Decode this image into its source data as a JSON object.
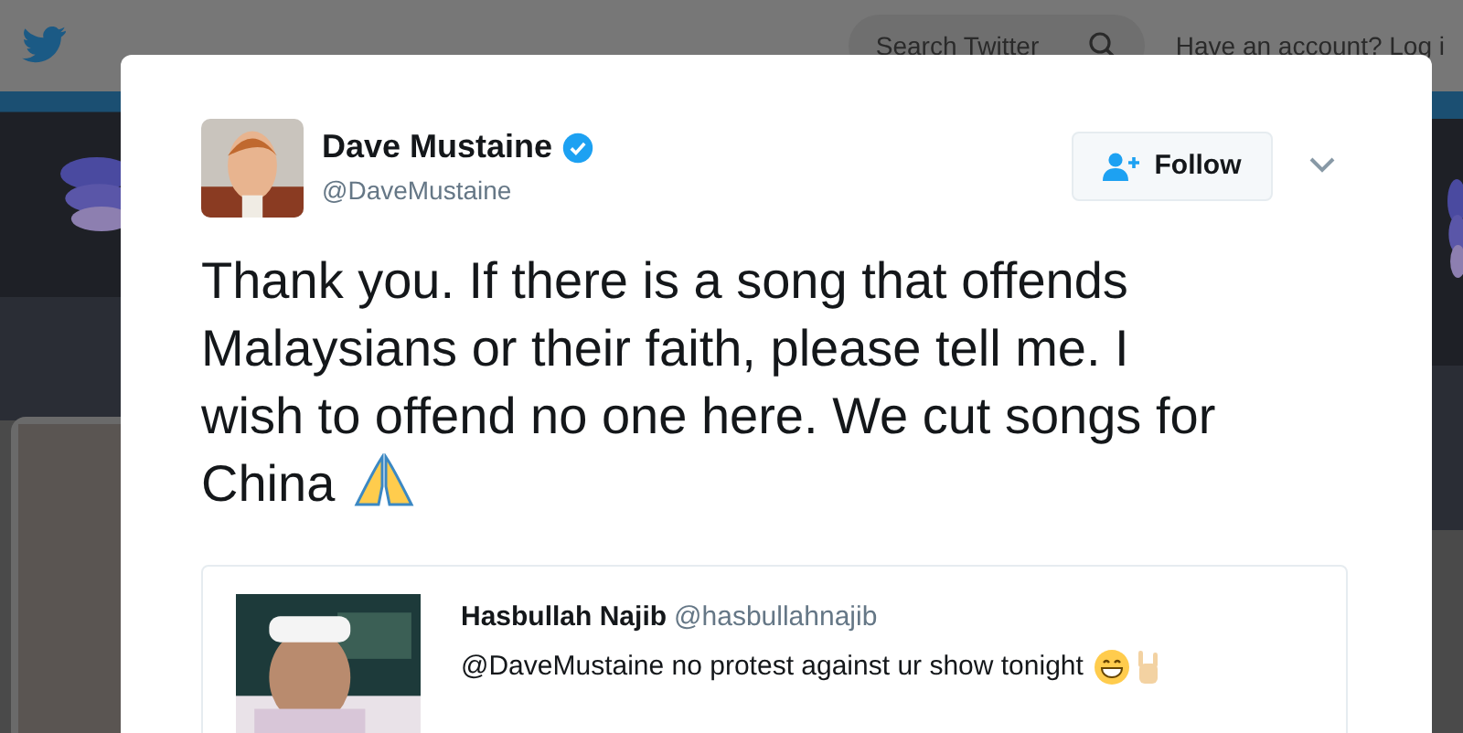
{
  "top_bar": {
    "search": {
      "placeholder": "Search Twitter"
    },
    "account_prompt": "Have an account? Log i"
  },
  "tweet": {
    "author": {
      "name": "Dave Mustaine",
      "handle": "@DaveMustaine",
      "verified": true
    },
    "follow_button": "Follow",
    "text": "Thank you. If there is a song that offends Malaysians or their faith, please tell me. I wish to offend no one here. We cut songs for China",
    "quoted": {
      "name": "Hasbullah Najib",
      "handle": "@hasbullahnajib",
      "text": "@DaveMustaine no protest against ur show tonight"
    }
  }
}
